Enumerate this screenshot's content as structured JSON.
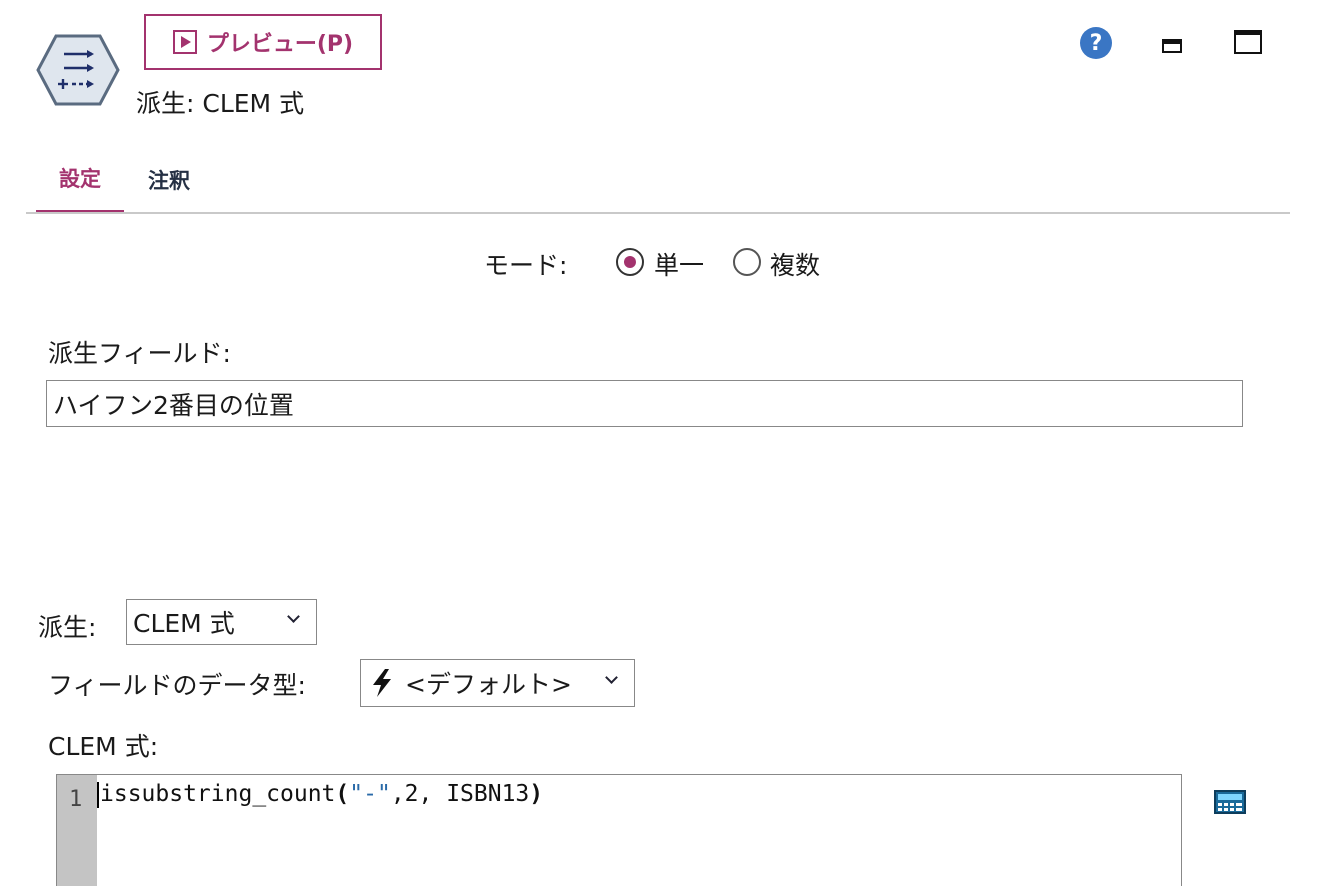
{
  "header": {
    "preview_label": "プレビュー(P)",
    "node_title": "派生: CLEM 式",
    "help_glyph": "?"
  },
  "tabs": [
    {
      "label": "設定",
      "active": true
    },
    {
      "label": "注釈",
      "active": false
    }
  ],
  "mode": {
    "label": "モード:",
    "options": [
      {
        "label": "単一",
        "selected": true
      },
      {
        "label": "複数",
        "selected": false
      }
    ]
  },
  "derive_field": {
    "label": "派生フィールド:",
    "value": "ハイフン2番目の位置"
  },
  "derive_as": {
    "label": "派生:",
    "selected": "CLEM 式"
  },
  "field_type": {
    "label": "フィールドのデータ型:",
    "selected": "<デフォルト>"
  },
  "clem": {
    "label": "CLEM 式:",
    "line_number": "1",
    "code_func": "issubstring_count",
    "code_open": "(",
    "code_string": "\"-\"",
    "code_args": ",2, ISBN13",
    "code_close": ")"
  },
  "colors": {
    "accent": "#a3336e",
    "help_blue": "#3a76c4",
    "string_token": "#2a6aa8"
  },
  "icons": {
    "node": "derive-node-icon",
    "preview": "play-icon",
    "help": "help-icon",
    "minimize": "minimize-icon",
    "maximize": "maximize-icon",
    "field_type": "lightning-bolt-icon",
    "builder": "expression-builder-icon"
  }
}
